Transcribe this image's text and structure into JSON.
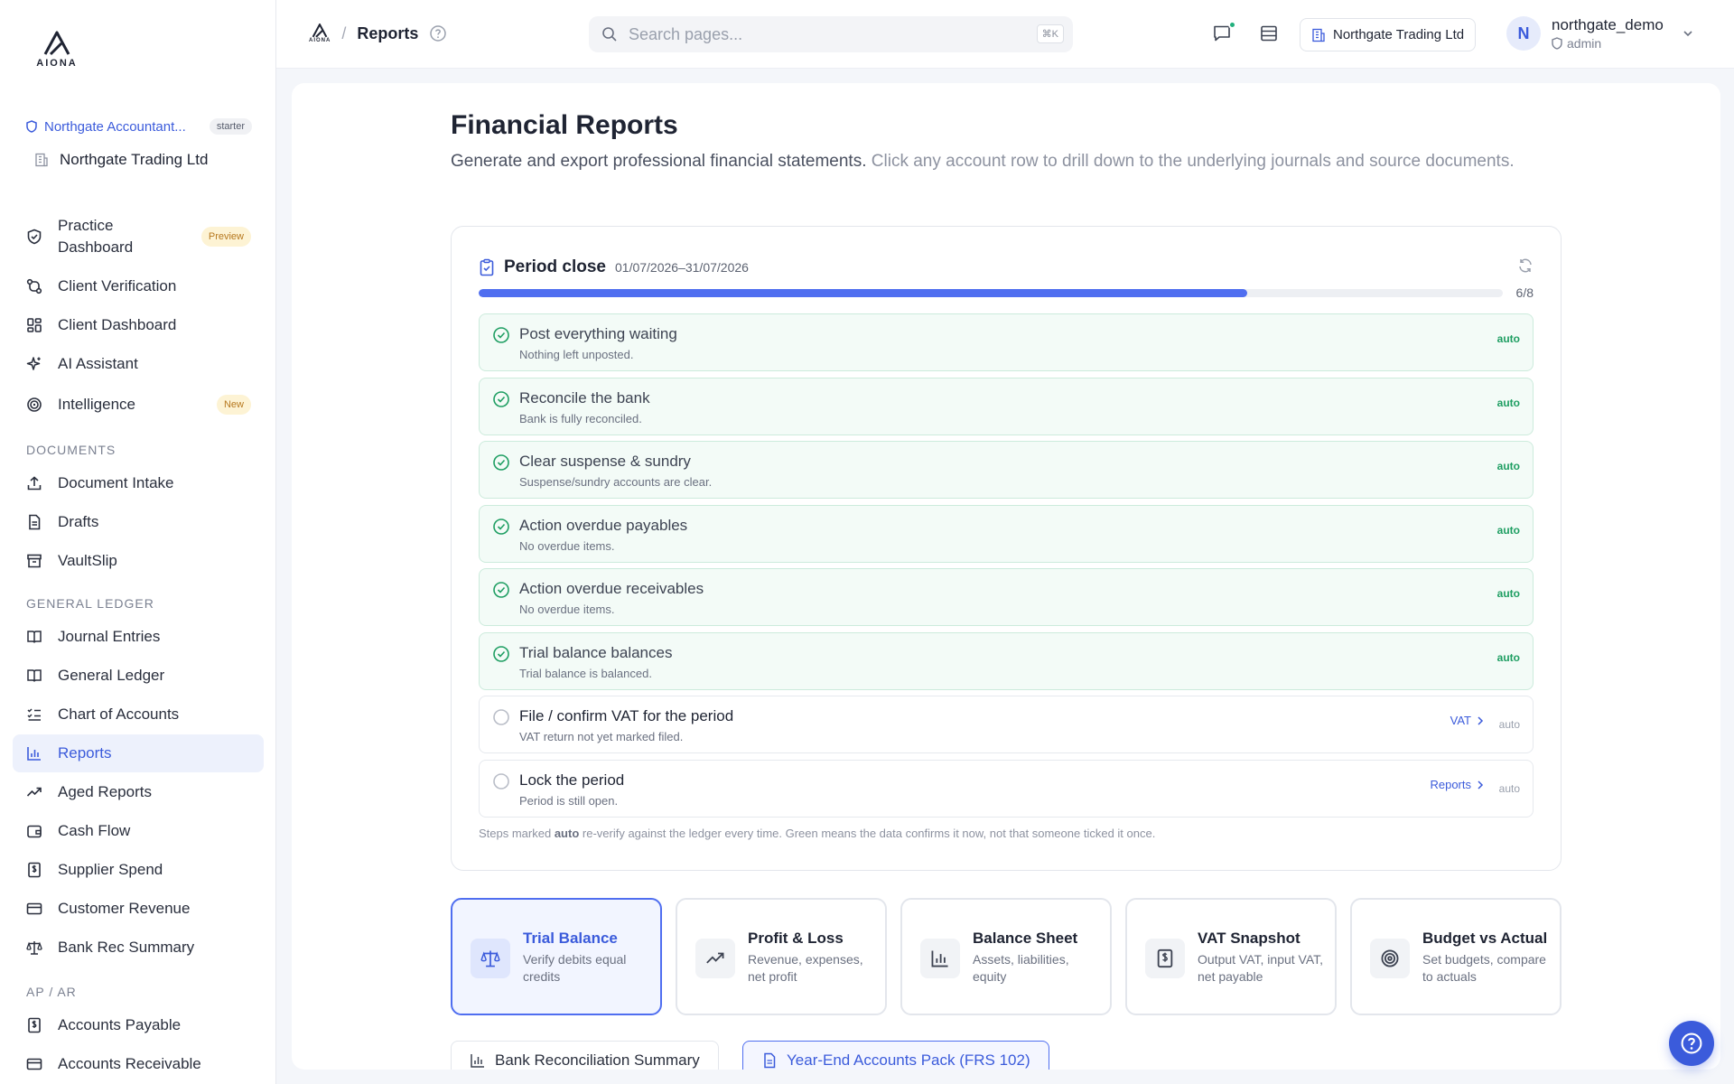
{
  "app": {
    "logo_text": "AIONA"
  },
  "sidebar": {
    "org_name": "Northgate Accountant...",
    "plan_badge": "starter",
    "client_name": "Northgate Trading Ltd",
    "items": [
      {
        "label": "Practice Dashboard",
        "badge": "Preview",
        "icon": "shield-check-icon"
      },
      {
        "label": "Client Verification",
        "icon": "git-compare-icon"
      },
      {
        "label": "Client Dashboard",
        "icon": "grid-icon"
      },
      {
        "label": "AI Assistant",
        "icon": "sparkles-icon"
      },
      {
        "label": "Intelligence",
        "badge": "New",
        "icon": "radar-icon"
      }
    ],
    "section_documents": "DOCUMENTS",
    "documents": [
      {
        "label": "Document Intake",
        "icon": "upload-icon"
      },
      {
        "label": "Drafts",
        "icon": "file-icon"
      },
      {
        "label": "VaultSlip",
        "icon": "archive-icon"
      }
    ],
    "section_gl": "GENERAL LEDGER",
    "gl": [
      {
        "label": "Journal Entries",
        "icon": "book-icon"
      },
      {
        "label": "General Ledger",
        "icon": "book-open-icon"
      },
      {
        "label": "Chart of Accounts",
        "icon": "list-checks-icon"
      },
      {
        "label": "Reports",
        "icon": "bar-chart-icon",
        "active": true
      },
      {
        "label": "Aged Reports",
        "icon": "trending-up-icon"
      },
      {
        "label": "Cash Flow",
        "icon": "wallet-icon"
      },
      {
        "label": "Supplier Spend",
        "icon": "receipt-icon"
      },
      {
        "label": "Customer Revenue",
        "icon": "credit-card-icon"
      },
      {
        "label": "Bank Rec Summary",
        "icon": "scale-icon"
      }
    ],
    "section_apar": "AP / AR",
    "apar": [
      {
        "label": "Accounts Payable",
        "icon": "receipt-icon"
      },
      {
        "label": "Accounts Receivable",
        "icon": "credit-card-icon"
      }
    ]
  },
  "topbar": {
    "logo_text": "AIONA",
    "breadcrumb_sep": "/",
    "title": "Reports",
    "search_placeholder": "Search pages...",
    "search_shortcut": "⌘K",
    "org_chip": "Northgate Trading Ltd",
    "user_initial": "N",
    "user_name": "northgate_demo",
    "user_role": "admin"
  },
  "page": {
    "title": "Financial Reports",
    "subtitle": "Generate and export professional financial statements.",
    "subtitle_hint": " Click any account row to drill down to the underlying journals and source documents."
  },
  "period_close": {
    "title": "Period close",
    "dates": "01/07/2026–31/07/2026",
    "progress_done": 6,
    "progress_total": 8,
    "progress_label": "6/8",
    "steps": [
      {
        "title": "Post everything waiting",
        "desc": "Nothing left unposted.",
        "status": "done",
        "tag": "auto"
      },
      {
        "title": "Reconcile the bank",
        "desc": "Bank is fully reconciled.",
        "status": "done",
        "tag": "auto"
      },
      {
        "title": "Clear suspense & sundry",
        "desc": "Suspense/sundry accounts are clear.",
        "status": "done",
        "tag": "auto"
      },
      {
        "title": "Action overdue payables",
        "desc": "No overdue items.",
        "status": "done",
        "tag": "auto"
      },
      {
        "title": "Action overdue receivables",
        "desc": "No overdue items.",
        "status": "done",
        "tag": "auto"
      },
      {
        "title": "Trial balance balances",
        "desc": "Trial balance is balanced.",
        "status": "done",
        "tag": "auto"
      },
      {
        "title": "File / confirm VAT for the period",
        "desc": "VAT return not yet marked filed.",
        "status": "pending",
        "tag": "auto",
        "link": "VAT"
      },
      {
        "title": "Lock the period",
        "desc": "Period is still open.",
        "status": "pending",
        "tag": "auto",
        "link": "Reports"
      }
    ],
    "note_pre": "Steps marked ",
    "note_bold": "auto",
    "note_post": " re-verify against the ledger every time. Green means the data confirms it now, not that someone ticked it once."
  },
  "report_tabs": [
    {
      "title": "Trial Balance",
      "desc": "Verify debits equal credits",
      "icon": "scale-icon",
      "active": true
    },
    {
      "title": "Profit & Loss",
      "desc": "Revenue, expenses, net profit",
      "icon": "trending-up-icon"
    },
    {
      "title": "Balance Sheet",
      "desc": "Assets, liabilities, equity",
      "icon": "bar-chart-icon"
    },
    {
      "title": "VAT Snapshot",
      "desc": "Output VAT, input VAT, net payable",
      "icon": "receipt-icon"
    },
    {
      "title": "Budget vs Actual",
      "desc": "Set budgets, compare to actuals",
      "icon": "target-icon"
    }
  ],
  "extra_reports": [
    {
      "label": "Bank Reconciliation Summary",
      "icon": "bar-chart-icon"
    },
    {
      "label": "Year-End Accounts Pack (FRS 102)",
      "icon": "file-icon"
    }
  ],
  "colors": {
    "accent": "#3b5bdb",
    "progress": "#4f6ef0",
    "success": "#1e9e62"
  }
}
